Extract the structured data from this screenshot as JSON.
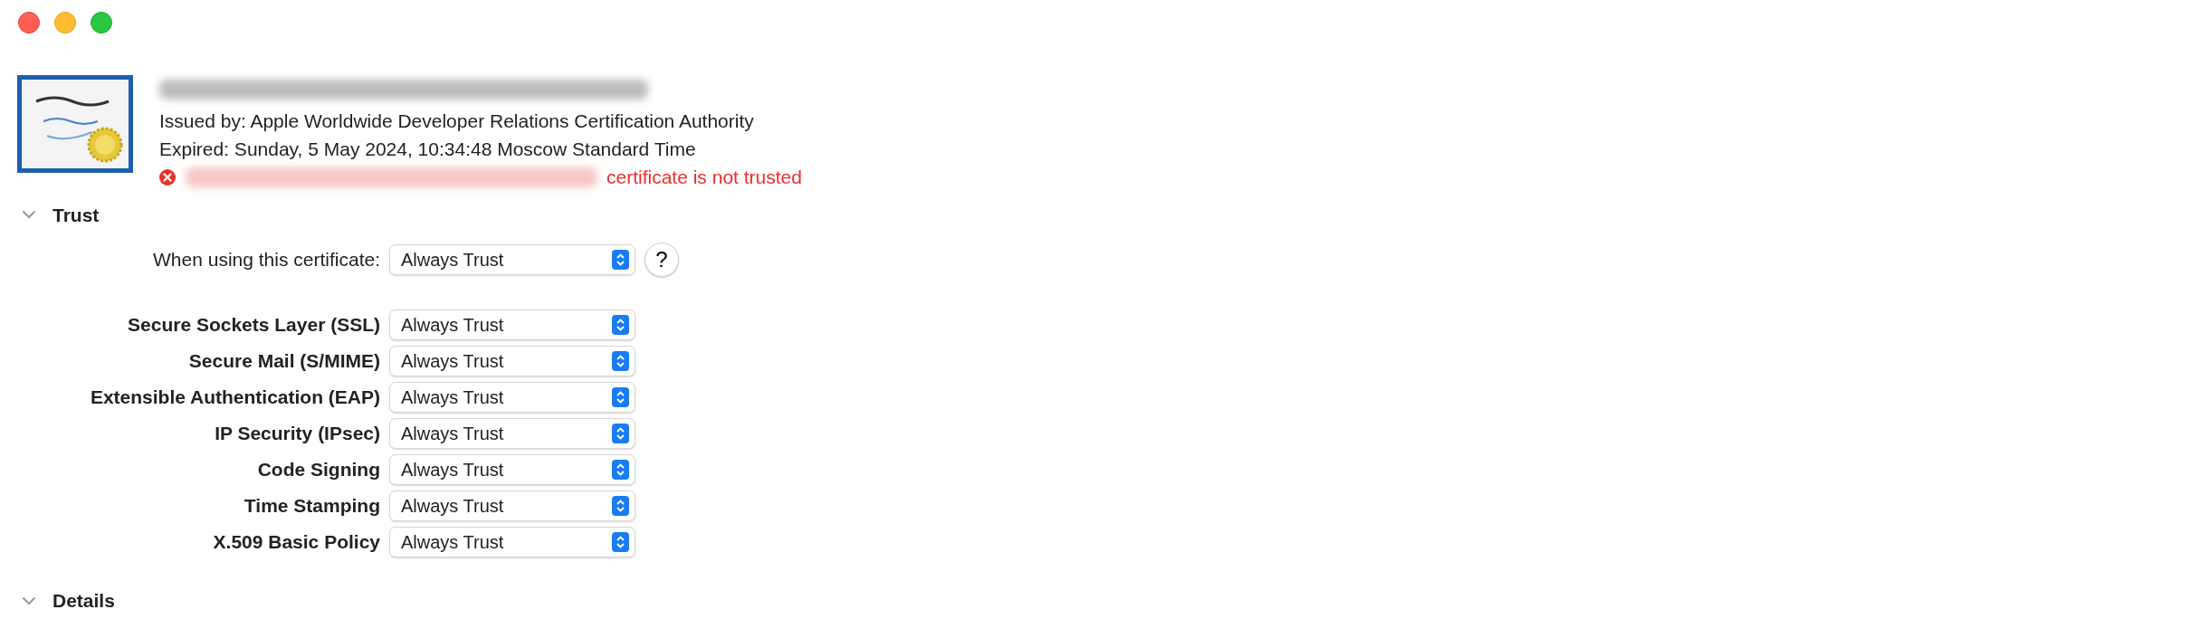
{
  "window": {
    "controls": [
      {
        "kind": "close"
      },
      {
        "kind": "minimize"
      },
      {
        "kind": "zoom"
      }
    ]
  },
  "certificate": {
    "issued_by": "Issued by: Apple Worldwide Developer Relations Certification Authority",
    "expired": "Expired: Sunday, 5 May 2024, 10:34:48 Moscow Standard Time",
    "error": "certificate is not trusted"
  },
  "sections": [
    {
      "title": "Trust",
      "general": {
        "label": "When using this certificate:",
        "value": "Always Trust"
      },
      "policies": [
        {
          "label": "Secure Sockets Layer (SSL)",
          "value": "Always Trust"
        },
        {
          "label": "Secure Mail (S/MIME)",
          "value": "Always Trust"
        },
        {
          "label": "Extensible Authentication (EAP)",
          "value": "Always Trust"
        },
        {
          "label": "IP Security (IPsec)",
          "value": "Always Trust"
        },
        {
          "label": "Code Signing",
          "value": "Always Trust"
        },
        {
          "label": "Time Stamping",
          "value": "Always Trust"
        },
        {
          "label": "X.509 Basic Policy",
          "value": "Always Trust"
        }
      ],
      "help": "?"
    },
    {
      "title": "Details"
    }
  ]
}
